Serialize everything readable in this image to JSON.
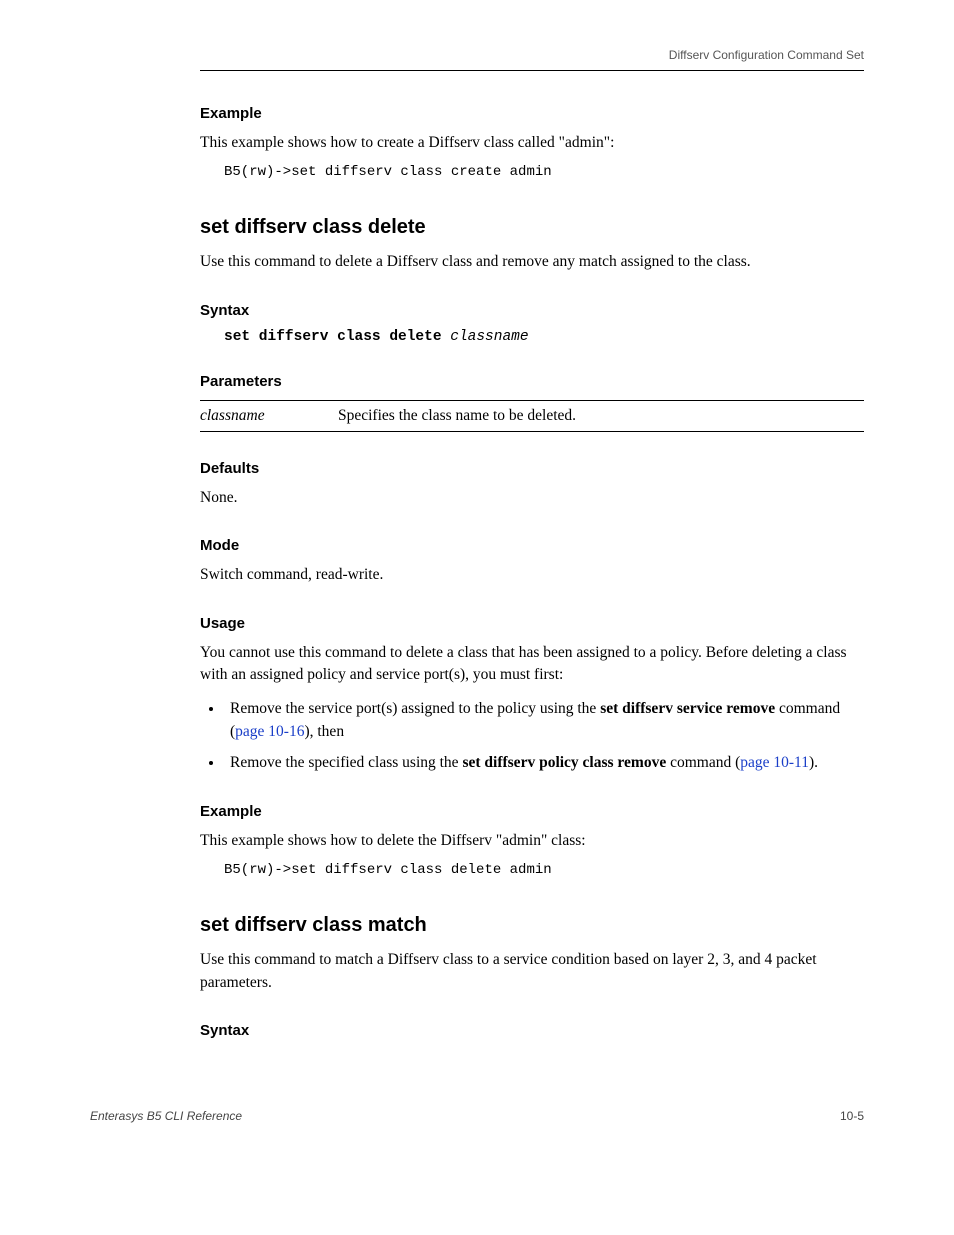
{
  "header": {
    "breadcrumb": "Diffserv Configuration Command Set"
  },
  "s1": {
    "heading_example": "Example",
    "example_intro": "This example shows how to create a Diffserv class called \"admin\":",
    "example_code": "B5(rw)->set diffserv class create admin"
  },
  "cmd_delete": {
    "title": "set diffserv class delete",
    "desc": "Use this command to delete a Diffserv class and remove any match assigned to the class.",
    "syntax_head": "Syntax",
    "syntax_cmd": "set diffserv class delete",
    "syntax_arg": "classname",
    "params_head": "Parameters",
    "param_name": "classname",
    "param_desc": "Specifies the class name to be deleted.",
    "defaults_head": "Defaults",
    "defaults_body": "None.",
    "mode_head": "Mode",
    "mode_body": "Switch command, read-write.",
    "usage_head": "Usage",
    "usage_body": "You cannot use this command to delete a class that has been assigned to a policy. Before deleting a class with an assigned policy and service port(s), you must first:",
    "bullet1_a": "Remove the service port(s) assigned to the policy using the ",
    "bullet1_cmd": "set diffserv service remove",
    "bullet1_b": " command (",
    "bullet1_link": "page 10-16",
    "bullet1_c": "), then",
    "bullet2_a": "Remove the specified class using the ",
    "bullet2_cmd": "set diffserv policy class remove",
    "bullet2_b": " command (",
    "bullet2_link": "page 10-11",
    "bullet2_c": ").",
    "example_head": "Example",
    "example_intro": "This example shows how to delete the Diffserv \"admin\" class:",
    "example_code": "B5(rw)->set diffserv class delete admin"
  },
  "cmd_match": {
    "title": "set diffserv class match",
    "desc": "Use this command to match a Diffserv class to a service condition based on layer 2, 3, and 4 packet parameters.",
    "syntax_head": "Syntax"
  },
  "footer": {
    "left": "Enterasys B5 CLI Reference",
    "right": "10-5"
  }
}
